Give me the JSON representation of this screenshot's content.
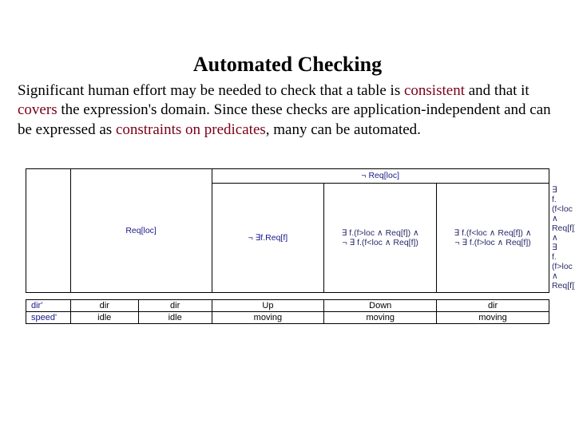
{
  "title": "Automated Checking",
  "para": {
    "p1a": "Significant human effort may be needed to check that a table is ",
    "p1b": "consistent",
    "p1c": " and that it ",
    "p1d": "covers",
    "p1e": " the expression's domain.  Since these checks are application-independent and can be expressed as ",
    "p1f": "constraints on predicates",
    "p1g": ", many can be automated."
  },
  "pred": {
    "r1c1": "Req[loc]",
    "r1c2": "¬ Req[loc]",
    "r2c1": "¬ ∃f.Req[f]",
    "r2c2_l1": "∃ f.(f>loc ∧ Req[f]) ∧",
    "r2c2_l2": "¬ ∃ f.(f<loc ∧ Req[f])",
    "r2c3_l1": "∃ f.(f<loc ∧ Req[f]) ∧",
    "r2c3_l2": "¬ ∃ f.(f>loc ∧ Req[f])",
    "r2c4_l1": "∃ f.(f<loc ∧ Req[f]) ∧",
    "r2c4_l2": "∃ f.(f>loc ∧ Req[f])"
  },
  "val": {
    "rowheads": [
      "dir'",
      "speed'"
    ],
    "rows": [
      [
        "dir",
        "dir",
        "Up",
        "Down",
        "dir"
      ],
      [
        "idle",
        "idle",
        "moving",
        "moving",
        "moving"
      ]
    ]
  }
}
